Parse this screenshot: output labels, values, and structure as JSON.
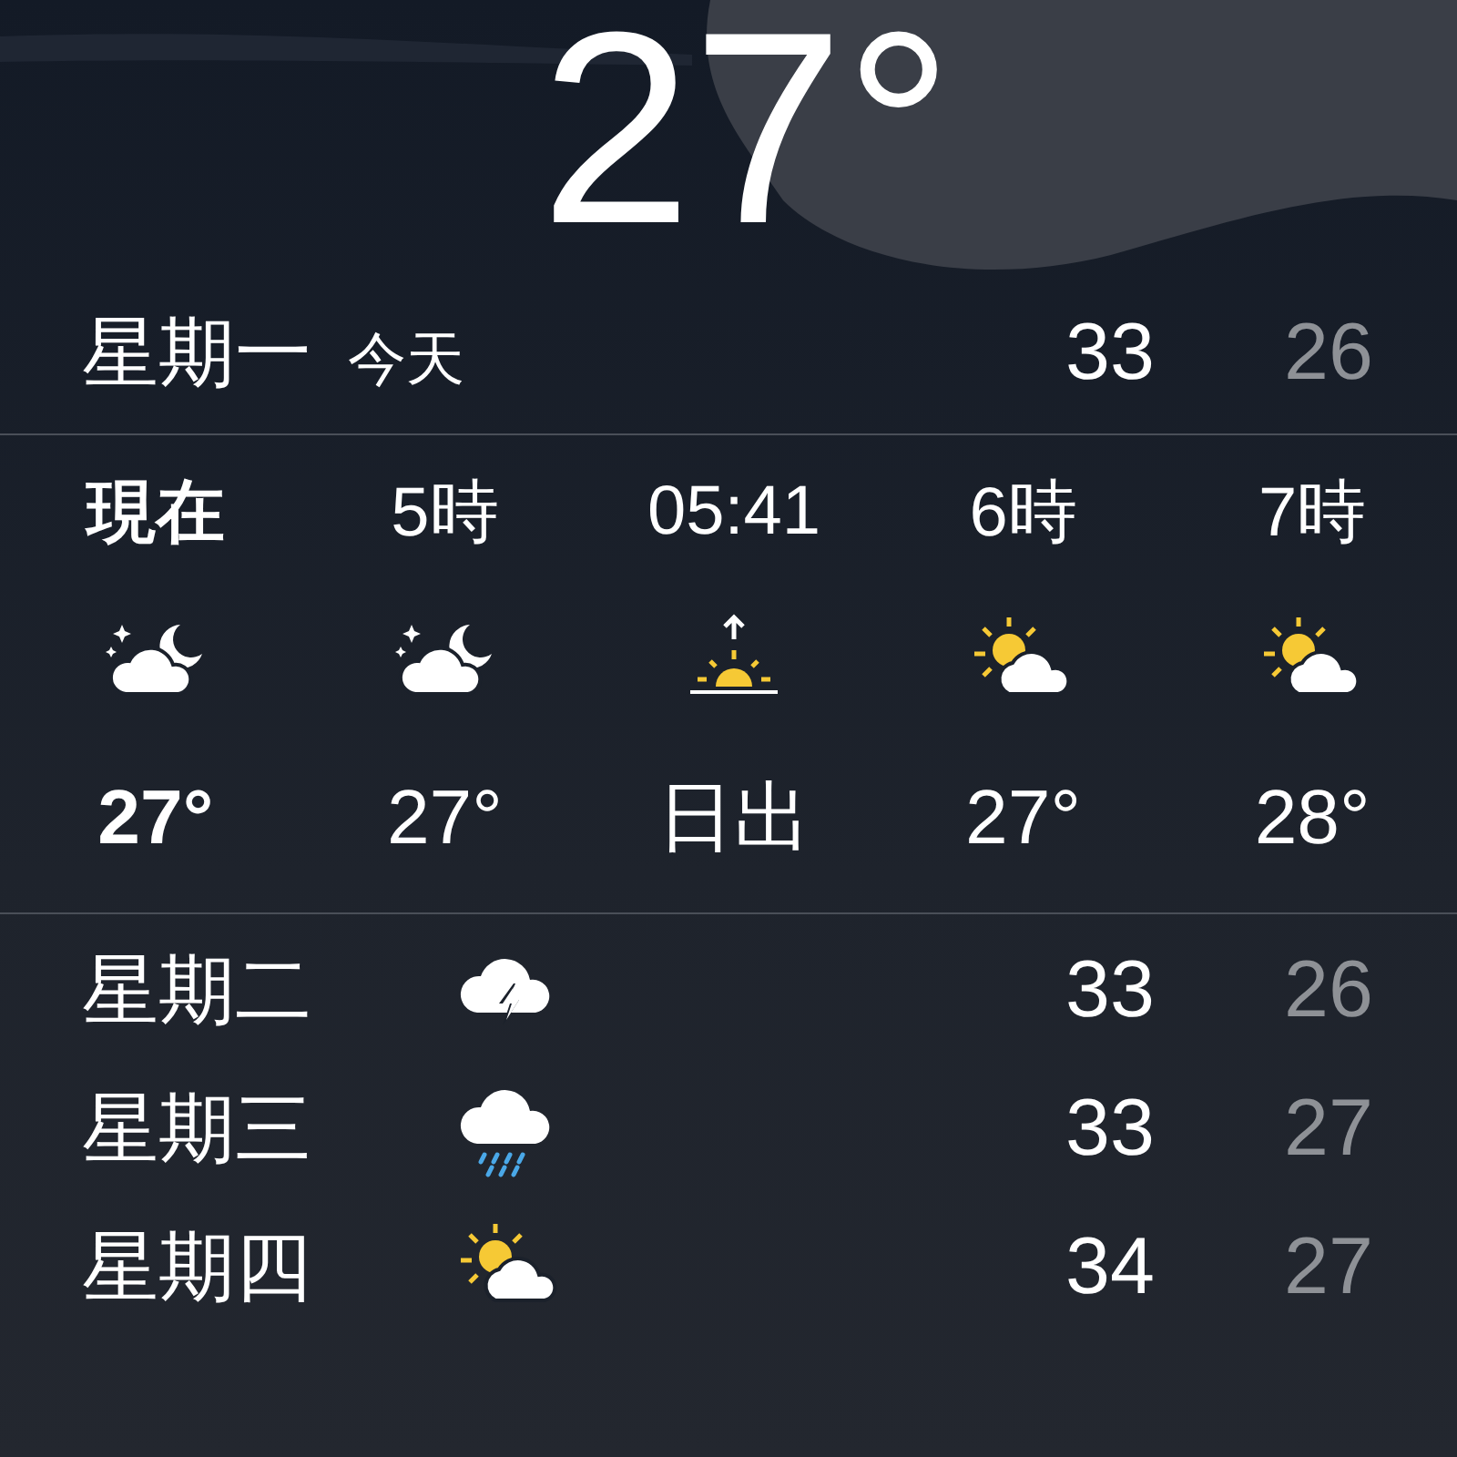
{
  "current": {
    "temperature": "27°"
  },
  "today": {
    "day": "星期一",
    "label": "今天",
    "high": "33",
    "low": "26"
  },
  "hourly": [
    {
      "time": "現在",
      "kind": "moon-cloud",
      "temp": "27°",
      "current": true
    },
    {
      "time": "5時",
      "kind": "moon-cloud",
      "temp": "27°",
      "current": false
    },
    {
      "time": "05:41",
      "kind": "sunrise",
      "temp": "日出",
      "current": false
    },
    {
      "time": "6時",
      "kind": "sun-cloud",
      "temp": "27°",
      "current": false
    },
    {
      "time": "7時",
      "kind": "sun-cloud",
      "temp": "28°",
      "current": false
    }
  ],
  "daily": [
    {
      "day": "星期二",
      "kind": "thunder",
      "high": "33",
      "low": "26"
    },
    {
      "day": "星期三",
      "kind": "rain",
      "high": "33",
      "low": "27"
    },
    {
      "day": "星期四",
      "kind": "sun-cloud",
      "high": "34",
      "low": "27"
    }
  ]
}
